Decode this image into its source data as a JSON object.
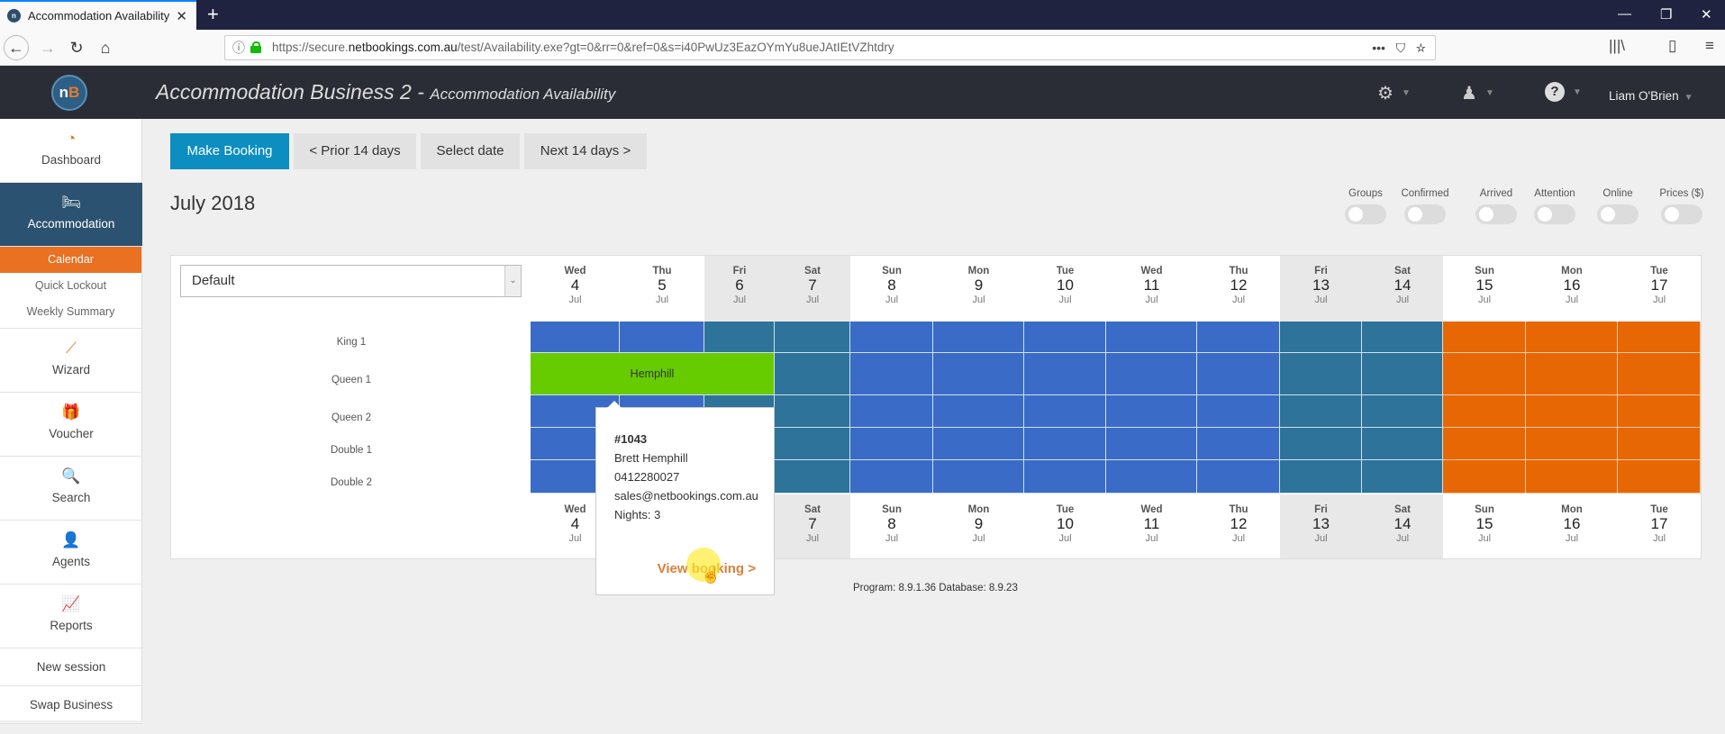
{
  "browser": {
    "tab_title": "Accommodation Availability",
    "url_host_prefix": "https://secure.",
    "url_host": "netbookings.com.au",
    "url_path": "/test/Availability.exe?gt=0&rr=0&ref=0&s=i40PwUz3EazOYmYu8ueJAtIEtVZhtdry",
    "icons": {
      "back": "arrow-left",
      "forward": "arrow-right",
      "reload": "reload",
      "home": "home",
      "more": "…",
      "pocket": "pocket",
      "bookmark": "star",
      "library": "library",
      "sidebar": "sidebar",
      "menu": "hamburger"
    }
  },
  "header": {
    "logo_text_a": "n",
    "logo_text_b": "B",
    "business": "Accommodation Business 2 -",
    "page": "Accommodation Availability",
    "user": "Liam O'Brien"
  },
  "sidebar": {
    "items": [
      {
        "label": "Dashboard",
        "icon": "dashboard-gauge"
      },
      {
        "label": "Accommodation",
        "icon": "bed",
        "active": true,
        "sub": [
          {
            "label": "Calendar",
            "active": true
          },
          {
            "label": "Quick Lockout"
          },
          {
            "label": "Weekly Summary"
          }
        ]
      },
      {
        "label": "Wizard",
        "icon": "magic-wand"
      },
      {
        "label": "Voucher",
        "icon": "gift"
      },
      {
        "label": "Search",
        "icon": "magnifier"
      },
      {
        "label": "Agents",
        "icon": "agent-person"
      },
      {
        "label": "Reports",
        "icon": "chart-up"
      }
    ],
    "links": [
      "New session",
      "Swap Business"
    ]
  },
  "toolbar": {
    "make_booking": "Make Booking",
    "prior": "< Prior 14 days",
    "select_date": "Select date",
    "next": "Next 14 days >"
  },
  "month_title": "July 2018",
  "toggles": [
    "Groups",
    "Confirmed",
    "Arrived",
    "Attention",
    "Online",
    "Prices ($)"
  ],
  "room_filter": {
    "selected": "Default"
  },
  "days": [
    {
      "dow": "Wed",
      "num": "4",
      "mon": "Jul",
      "weekend": false
    },
    {
      "dow": "Thu",
      "num": "5",
      "mon": "Jul",
      "weekend": false
    },
    {
      "dow": "Fri",
      "num": "6",
      "mon": "Jul",
      "weekend": true
    },
    {
      "dow": "Sat",
      "num": "7",
      "mon": "Jul",
      "weekend": true
    },
    {
      "dow": "Sun",
      "num": "8",
      "mon": "Jul",
      "weekend": false
    },
    {
      "dow": "Mon",
      "num": "9",
      "mon": "Jul",
      "weekend": false
    },
    {
      "dow": "Tue",
      "num": "10",
      "mon": "Jul",
      "weekend": false
    },
    {
      "dow": "Wed",
      "num": "11",
      "mon": "Jul",
      "weekend": false
    },
    {
      "dow": "Thu",
      "num": "12",
      "mon": "Jul",
      "weekend": false
    },
    {
      "dow": "Fri",
      "num": "13",
      "mon": "Jul",
      "weekend": true
    },
    {
      "dow": "Sat",
      "num": "14",
      "mon": "Jul",
      "weekend": true
    },
    {
      "dow": "Sun",
      "num": "15",
      "mon": "Jul",
      "weekend": false,
      "closed": true
    },
    {
      "dow": "Mon",
      "num": "16",
      "mon": "Jul",
      "weekend": false,
      "closed": true
    },
    {
      "dow": "Tue",
      "num": "17",
      "mon": "Jul",
      "weekend": false,
      "closed": true
    }
  ],
  "rooms": [
    "King 1",
    "Queen 1",
    "Queen 2",
    "Double 1",
    "Double 2"
  ],
  "colors": {
    "available": "#3a6bc6",
    "weekend": "#2e7399",
    "closed": "#e86705",
    "booked": "#66cc00",
    "accent": "#0c8ec0",
    "sidebar_active": "#2b5270",
    "sub_active": "#ea7022"
  },
  "bookings": [
    {
      "room": "Queen 1",
      "name": "Hemphill",
      "start_day": 0,
      "nights": 3
    }
  ],
  "popup": {
    "ref": "#1043",
    "guest": "Brett Hemphill",
    "phone": "0412280027",
    "email": "sales@netbookings.com.au",
    "nights": "Nights: 3",
    "view": "View booking >"
  },
  "footer": "Program: 8.9.1.36 Database: 8.9.23"
}
